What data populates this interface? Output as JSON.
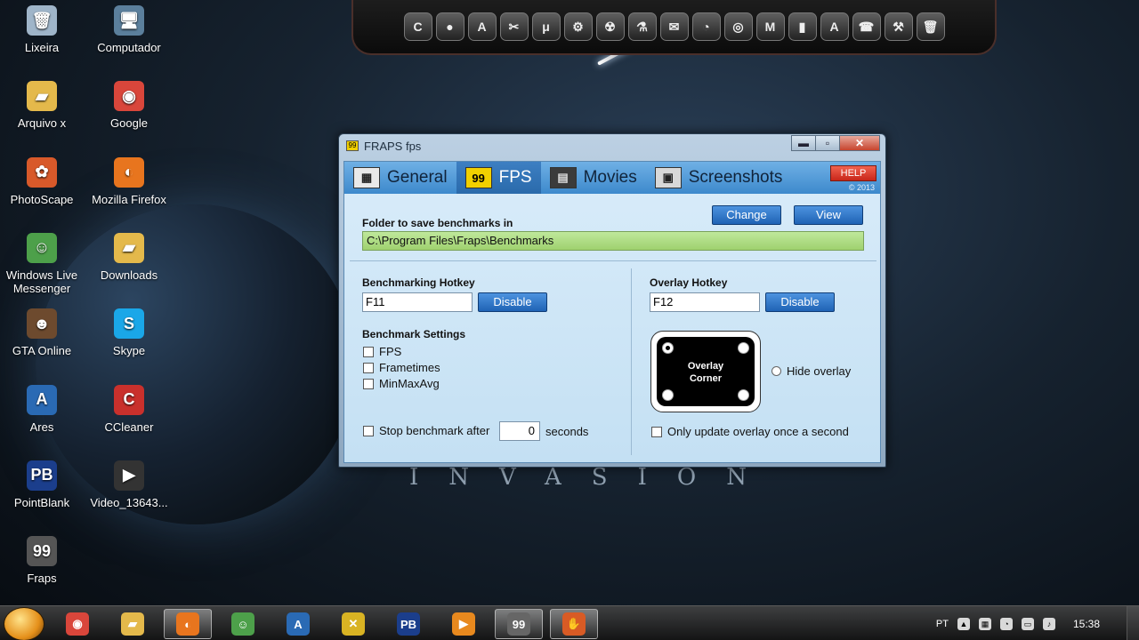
{
  "desktop": {
    "wallpaper_text": "INVASION",
    "icons": [
      {
        "label": "Lixeira",
        "icon": "recycle-bin-icon",
        "glyph": "🗑",
        "color": "#9fb5c9"
      },
      {
        "label": "Computador",
        "icon": "computer-icon",
        "glyph": "🖥",
        "color": "#5b7f9c"
      },
      {
        "label": "Arquivo x",
        "icon": "folder-icon",
        "glyph": "▰",
        "color": "#e4b94b"
      },
      {
        "label": "Google",
        "icon": "chrome-icon",
        "glyph": "◉",
        "color": "#d9463b"
      },
      {
        "label": "PhotoScape",
        "icon": "photoscape-icon",
        "glyph": "✿",
        "color": "#d8592a"
      },
      {
        "label": "Mozilla Firefox",
        "icon": "firefox-icon",
        "glyph": "◐",
        "color": "#e8751e"
      },
      {
        "label": "Windows Live Messenger",
        "icon": "messenger-icon",
        "glyph": "☺",
        "color": "#4da04a"
      },
      {
        "label": "Downloads",
        "icon": "folder-icon",
        "glyph": "▰",
        "color": "#e4b94b"
      },
      {
        "label": "GTA Online",
        "icon": "gta-icon",
        "glyph": "☻",
        "color": "#6d4a2e"
      },
      {
        "label": "Skype",
        "icon": "skype-icon",
        "glyph": "S",
        "color": "#1aa7e8"
      },
      {
        "label": "Ares",
        "icon": "ares-icon",
        "glyph": "A",
        "color": "#2a6ab4"
      },
      {
        "label": "CCleaner",
        "icon": "ccleaner-icon",
        "glyph": "C",
        "color": "#c9302c"
      },
      {
        "label": "PointBlank",
        "icon": "pointblank-icon",
        "glyph": "PB",
        "color": "#1b3e8c"
      },
      {
        "label": "Video_13643...",
        "icon": "video-file-icon",
        "glyph": "▶",
        "color": "#333333"
      },
      {
        "label": "Fraps",
        "icon": "fraps-icon",
        "glyph": "99",
        "color": "#555555"
      }
    ]
  },
  "dock": {
    "items": [
      "C",
      "●",
      "A",
      "✂",
      "μ",
      "⚙",
      "☢",
      "⚗",
      "✉",
      "◔",
      "◎",
      "M",
      "▮",
      "A",
      "☎",
      "⚒",
      "🗑"
    ]
  },
  "window": {
    "title": "FRAPS fps",
    "title_icon": "99",
    "controls": {
      "minimize": "▬",
      "maximize": "▫",
      "close": "✕"
    },
    "tabs": [
      {
        "label": "General",
        "icon": "grid-icon",
        "glyph": "▦",
        "active": false
      },
      {
        "label": "FPS",
        "icon": "fps-99-icon",
        "glyph": "99",
        "active": true
      },
      {
        "label": "Movies",
        "icon": "film-icon",
        "glyph": "▤",
        "active": false
      },
      {
        "label": "Screenshots",
        "icon": "screenshot-icon",
        "glyph": "▣",
        "active": false
      }
    ],
    "help_label": "HELP",
    "copyright": "© 2013",
    "folder_label": "Folder to save benchmarks in",
    "change_label": "Change",
    "view_label": "View",
    "folder_path": "C:\\Program Files\\Fraps\\Benchmarks",
    "bench_hotkey_label": "Benchmarking Hotkey",
    "bench_hotkey_value": "F11",
    "bench_disable_label": "Disable",
    "overlay_hotkey_label": "Overlay Hotkey",
    "overlay_hotkey_value": "F12",
    "overlay_disable_label": "Disable",
    "bench_settings_label": "Benchmark Settings",
    "checks": {
      "fps": "FPS",
      "frametimes": "Frametimes",
      "minmaxavg": "MinMaxAvg"
    },
    "stop_label": "Stop benchmark after",
    "stop_value": "0",
    "seconds_label": "seconds",
    "overlay_corner_line1": "Overlay",
    "overlay_corner_line2": "Corner",
    "hide_overlay_label": "Hide overlay",
    "update_overlay_label": "Only update overlay once a second"
  },
  "taskbar": {
    "items": [
      {
        "icon": "chrome-icon",
        "glyph": "◉",
        "color": "#d9463b"
      },
      {
        "icon": "explorer-icon",
        "glyph": "▰",
        "color": "#e4b94b"
      },
      {
        "icon": "firefox-icon",
        "glyph": "◐",
        "color": "#e8751e"
      },
      {
        "icon": "messenger-icon",
        "glyph": "☺",
        "color": "#4da04a"
      },
      {
        "icon": "ares-icon",
        "glyph": "A",
        "color": "#2a6ab4"
      },
      {
        "icon": "tool-icon",
        "glyph": "✕",
        "color": "#d9b323"
      },
      {
        "icon": "pointblank-icon",
        "glyph": "PB",
        "color": "#1b3e8c"
      },
      {
        "icon": "media-player-icon",
        "glyph": "▶",
        "color": "#e8891e"
      },
      {
        "icon": "fraps-icon",
        "glyph": "99",
        "color": "#666666"
      },
      {
        "icon": "glove-icon",
        "glyph": "✋",
        "color": "#d85b25"
      }
    ],
    "language": "PT",
    "clock": "15:38"
  }
}
